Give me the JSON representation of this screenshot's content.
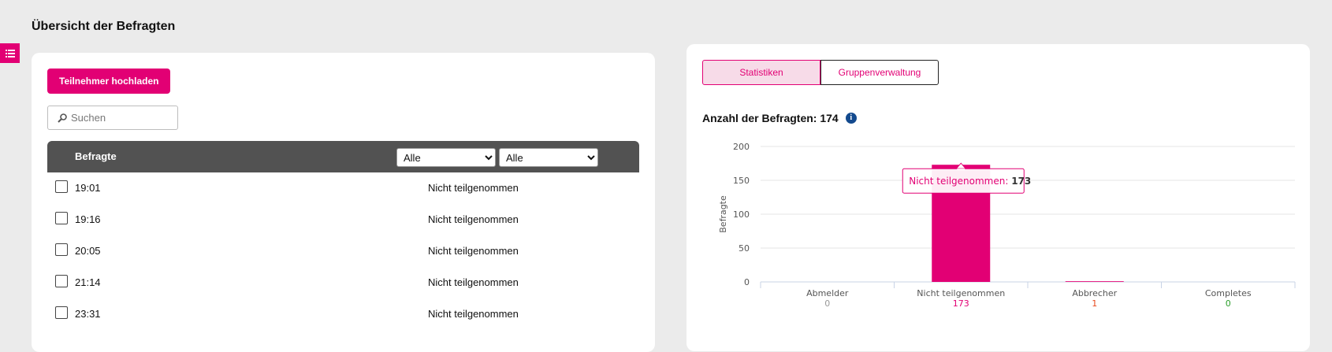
{
  "page": {
    "title": "Übersicht der Befragten"
  },
  "sidebar_toggle": {
    "icon": "list-icon"
  },
  "participants": {
    "upload_label": "Teilnehmer hochladen",
    "search": {
      "placeholder": "Suchen",
      "value": ""
    },
    "table": {
      "header_label": "Befragte",
      "filter1": {
        "selected": "Alle"
      },
      "filter2": {
        "selected": "Alle"
      },
      "rows": [
        {
          "time": "19:01",
          "status": "Nicht teilgenommen"
        },
        {
          "time": "19:16",
          "status": "Nicht teilgenommen"
        },
        {
          "time": "20:05",
          "status": "Nicht teilgenommen"
        },
        {
          "time": "21:14",
          "status": "Nicht teilgenommen"
        },
        {
          "time": "23:31",
          "status": "Nicht teilgenommen"
        }
      ]
    }
  },
  "stats": {
    "tabs": [
      {
        "label": "Statistiken",
        "active": true
      },
      {
        "label": "Gruppenverwaltung",
        "active": false
      }
    ],
    "count_label": "Anzahl der Befragten: 174",
    "info_icon": "info-icon",
    "tooltip": {
      "label": "Nicht teilgenommen: ",
      "value": "173"
    }
  },
  "chart_data": {
    "type": "bar",
    "categories": [
      "Abmelder",
      "Nicht teilgenommen",
      "Abbrecher",
      "Completes"
    ],
    "values": [
      0,
      173,
      1,
      0
    ],
    "value_labels": [
      "0",
      "173",
      "1",
      "0"
    ],
    "value_label_colors": [
      "#999999",
      "#e20074",
      "#e8481c",
      "#2a9d2a"
    ],
    "ylabel": "Befragte",
    "yticks": [
      0,
      50,
      100,
      150,
      200
    ],
    "ylim": [
      0,
      200
    ],
    "grid": true,
    "bar_color": "#e20074"
  },
  "colors": {
    "accent": "#e20074",
    "header_bg": "#525252",
    "info": "#134a8e"
  }
}
